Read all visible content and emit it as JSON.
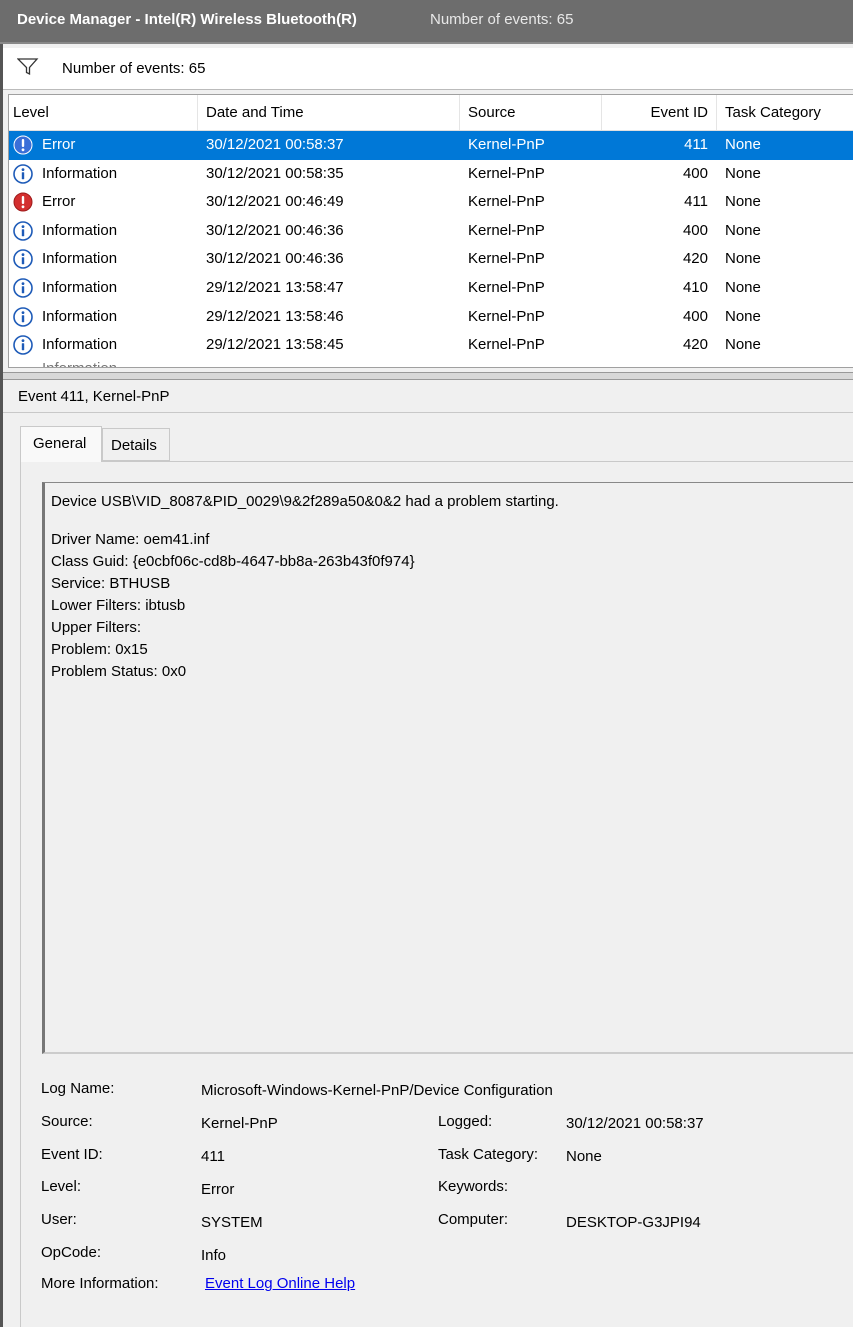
{
  "window": {
    "title": "Device Manager - Intel(R) Wireless Bluetooth(R)",
    "event_count": "Number of events: 65"
  },
  "filter": {
    "icon": "filter-icon",
    "text": "Number of events: 65"
  },
  "table": {
    "headers": [
      "Level",
      "Date and Time",
      "Source",
      "Event ID",
      "Task Category"
    ],
    "rows": [
      {
        "level": "Error",
        "icon": "error-icon",
        "date": "30/12/2021 00:58:37",
        "source": "Kernel-PnP",
        "event_id": "411",
        "task": "None",
        "selected": true
      },
      {
        "level": "Information",
        "icon": "info-icon",
        "date": "30/12/2021 00:58:35",
        "source": "Kernel-PnP",
        "event_id": "400",
        "task": "None"
      },
      {
        "level": "Error",
        "icon": "error-icon",
        "date": "30/12/2021 00:46:49",
        "source": "Kernel-PnP",
        "event_id": "411",
        "task": "None"
      },
      {
        "level": "Information",
        "icon": "info-icon",
        "date": "30/12/2021 00:46:36",
        "source": "Kernel-PnP",
        "event_id": "400",
        "task": "None"
      },
      {
        "level": "Information",
        "icon": "info-icon",
        "date": "30/12/2021 00:46:36",
        "source": "Kernel-PnP",
        "event_id": "420",
        "task": "None"
      },
      {
        "level": "Information",
        "icon": "info-icon",
        "date": "29/12/2021 13:58:47",
        "source": "Kernel-PnP",
        "event_id": "410",
        "task": "None"
      },
      {
        "level": "Information",
        "icon": "info-icon",
        "date": "29/12/2021 13:58:46",
        "source": "Kernel-PnP",
        "event_id": "400",
        "task": "None"
      },
      {
        "level": "Information",
        "icon": "info-icon",
        "date": "29/12/2021 13:58:45",
        "source": "Kernel-PnP",
        "event_id": "420",
        "task": "None"
      }
    ]
  },
  "detail": {
    "header": "Event 411, Kernel-PnP",
    "tabs": [
      "General",
      "Details"
    ],
    "message": [
      "Device USB\\VID_8087&PID_0029\\9&2f289a50&0&2 had a problem starting.",
      "",
      "Driver Name: oem41.inf",
      "Class Guid: {e0cbf06c-cd8b-4647-bb8a-263b43f0f974}",
      "Service: BTHUSB",
      "Lower Filters: ibtusb",
      "Upper Filters:",
      "Problem: 0x15",
      "Problem Status: 0x0"
    ],
    "props": {
      "log_name_label": "Log Name:",
      "log_name": "Microsoft-Windows-Kernel-PnP/Device Configuration",
      "source_label": "Source:",
      "source": "Kernel-PnP",
      "logged_label": "Logged:",
      "logged": "30/12/2021 00:58:37",
      "event_id_label": "Event ID:",
      "event_id": "411",
      "task_label": "Task Category:",
      "task": "None",
      "level_label": "Level:",
      "level": "Error",
      "keywords_label": "Keywords:",
      "keywords": "",
      "user_label": "User:",
      "user": "SYSTEM",
      "computer_label": "Computer:",
      "computer": "DESKTOP-G3JPI94",
      "opcode_label": "OpCode:",
      "opcode": "Info",
      "more_info_label": "More Information:",
      "more_info_link": "Event Log Online Help"
    }
  },
  "colors": {
    "selection": "#0078d7",
    "titlebar": "#6d6d6d",
    "error": "#d32f2f",
    "info": "#1e5bb8"
  }
}
